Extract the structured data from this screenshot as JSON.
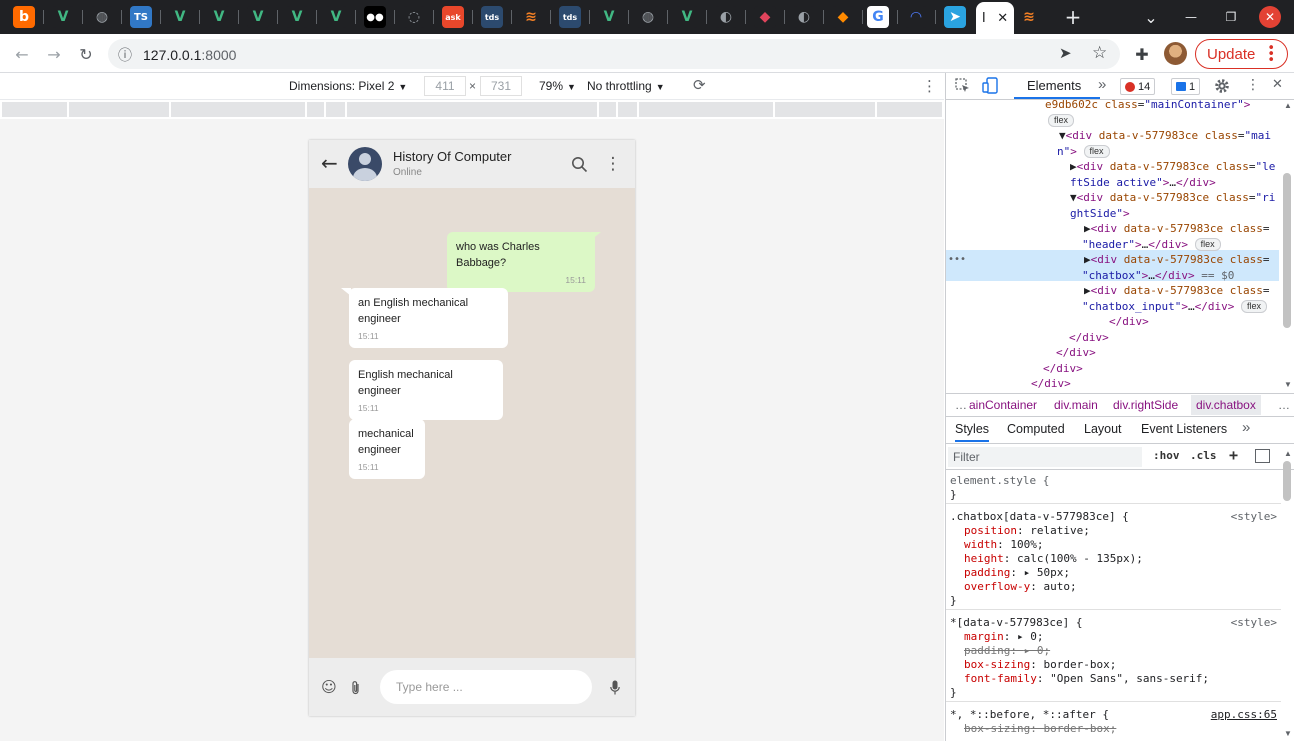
{
  "browser": {
    "tabs": [
      {
        "icon": "b",
        "bg": "#ff6a00",
        "fg": "#ffffff"
      },
      {
        "icon": "V",
        "bg": "#202124",
        "fg": "#41b883"
      },
      {
        "icon": "◍",
        "bg": "#202124",
        "fg": "#9aa0a6"
      },
      {
        "icon": "TS",
        "bg": "#3178c6",
        "fg": "#ffffff"
      },
      {
        "icon": "V",
        "bg": "#202124",
        "fg": "#41b883"
      },
      {
        "icon": "V",
        "bg": "#202124",
        "fg": "#41b883"
      },
      {
        "icon": "V",
        "bg": "#202124",
        "fg": "#41b883"
      },
      {
        "icon": "V",
        "bg": "#202124",
        "fg": "#41b883"
      },
      {
        "icon": "V",
        "bg": "#202124",
        "fg": "#41b883"
      },
      {
        "icon": "●●",
        "bg": "#000000",
        "fg": "#ffffff"
      },
      {
        "icon": "◌",
        "bg": "#202124",
        "fg": "#9aa0a6"
      },
      {
        "icon": "ask",
        "bg": "#e8472b",
        "fg": "#ffffff"
      },
      {
        "icon": "tds",
        "bg": "#2c4a6e",
        "fg": "#ffffff"
      },
      {
        "icon": "≋",
        "bg": "#202124",
        "fg": "#f48024"
      },
      {
        "icon": "tds",
        "bg": "#2c4a6e",
        "fg": "#ffffff"
      },
      {
        "icon": "V",
        "bg": "#202124",
        "fg": "#41b883"
      },
      {
        "icon": "◍",
        "bg": "#202124",
        "fg": "#9aa0a6"
      },
      {
        "icon": "V",
        "bg": "#202124",
        "fg": "#41b883"
      },
      {
        "icon": "◐",
        "bg": "#202124",
        "fg": "#9aa0a6"
      },
      {
        "icon": "◆",
        "bg": "#202124",
        "fg": "#e0445c"
      },
      {
        "icon": "◐",
        "bg": "#202124",
        "fg": "#9aa0a6"
      },
      {
        "icon": "◆",
        "bg": "#202124",
        "fg": "#ff8a00"
      },
      {
        "icon": "G",
        "bg": "#ffffff",
        "fg": "#4285f4"
      },
      {
        "icon": "◠",
        "bg": "#202124",
        "fg": "#4f7cff"
      },
      {
        "icon": "➤",
        "bg": "#2aa3e0",
        "fg": "#ffffff"
      }
    ],
    "active_tab": {
      "title": "I",
      "close": "✕",
      "icon": "≋"
    },
    "new_tab": "+",
    "tab_search": "⌄",
    "window_controls": {
      "minimize": "—",
      "restore": "❐",
      "close": "✕"
    },
    "url_host": "127.0.0.1",
    "url_port": ":8000",
    "update_label": "Update",
    "toolbar_icons": {
      "back": "←",
      "forward": "→",
      "reload": "↻",
      "info": "ⓘ",
      "send": "➤",
      "star": "☆",
      "extensions": "✚"
    }
  },
  "device_toolbar": {
    "dimensions_label": "Dimensions: Pixel 2",
    "width": "411",
    "times": "×",
    "height": "731",
    "zoom": "79%",
    "throttling": "No throttling",
    "caret": "▼",
    "rotate_icon": "⟳",
    "more": "⋮"
  },
  "chat": {
    "contact_name": "History Of Computer",
    "contact_status": "Online",
    "icons": {
      "back": "←",
      "search": "⌕",
      "menu": "⋮",
      "emoji": "☺",
      "attach": "⌇",
      "mic": "🎤"
    },
    "messages": [
      {
        "text": "who was Charles Babbage?",
        "time": "15:11",
        "type": "sent"
      },
      {
        "text": "an English mechanical engineer",
        "time": "15:11",
        "type": "received"
      },
      {
        "text": "English mechanical engineer",
        "time": "15:11",
        "type": "received"
      },
      {
        "text": "mechanical engineer",
        "time": "15:11",
        "type": "received"
      }
    ],
    "input_placeholder": "Type here ..."
  },
  "devtools": {
    "tab_elements": "Elements",
    "more_tabs": "»",
    "errors": "14",
    "messages": "1",
    "dom_lines": [
      {
        "html": "<span class='attr'>e9db602c</span> <span class='attr'>class</span>=<span class='val'>\"mainContainer\"</span><span class='tag'>&gt;</span>"
      },
      {
        "html": "<span class='pill'>flex</span>"
      },
      {
        "html": "▼<span class='tag'>&lt;div</span> <span class='attr'>data-v-577983ce</span> <span class='attr'>class</span>=<span class='val'>\"mai</span>"
      },
      {
        "html": "<span class='val'>n\"</span><span class='tag'>&gt;</span> <span class='pill'>flex</span>"
      },
      {
        "html": "▶<span class='tag'>&lt;div</span> <span class='attr'>data-v-577983ce</span> <span class='attr'>class</span>=<span class='val'>\"le</span>"
      },
      {
        "html": "<span class='val'>ftSide active\"</span><span class='tag'>&gt;</span>…<span class='tag'>&lt;/div&gt;</span>"
      },
      {
        "html": "▼<span class='tag'>&lt;div</span> <span class='attr'>data-v-577983ce</span> <span class='attr'>class</span>=<span class='val'>\"ri</span>"
      },
      {
        "html": "<span class='val'>ghtSide\"</span><span class='tag'>&gt;</span>"
      },
      {
        "html": "▶<span class='tag'>&lt;div</span> <span class='attr'>data-v-577983ce</span> <span class='attr'>class</span>="
      },
      {
        "html": "<span class='val'>\"header\"</span><span class='tag'>&gt;</span>…<span class='tag'>&lt;/div&gt;</span> <span class='pill'>flex</span>"
      },
      {
        "html": "▶<span class='tag'>&lt;div</span> <span class='attr'>data-v-577983ce</span> <span class='attr'>class</span>="
      },
      {
        "html": "<span class='val'>\"chatbox\"</span><span class='tag'>&gt;</span>…<span class='tag'>&lt;/div&gt;</span> <span style='color:#5f6368'>== $0</span>"
      },
      {
        "html": "▶<span class='tag'>&lt;div</span> <span class='attr'>data-v-577983ce</span> <span class='attr'>class</span>="
      },
      {
        "html": "<span class='val'>\"chatbox_input\"</span><span class='tag'>&gt;</span>…<span class='tag'>&lt;/div&gt;</span> <span class='pill'>flex</span>"
      },
      {
        "html": "<span class='tag'>&lt;/div&gt;</span>"
      },
      {
        "html": "<span class='tag'>&lt;/div&gt;</span>"
      },
      {
        "html": "<span class='tag'>&lt;/div&gt;</span>"
      },
      {
        "html": "<span class='tag'>&lt;/div&gt;</span>"
      },
      {
        "html": "<span class='tag'>&lt;/div&gt;</span>"
      }
    ],
    "breadcrumbs": [
      "…",
      "ainContainer",
      "div.main",
      "div.rightSide",
      "div.chatbox",
      "…"
    ],
    "subtabs": [
      "Styles",
      "Computed",
      "Layout",
      "Event Listeners",
      "»"
    ],
    "filter_placeholder": "Filter",
    "hov": ":hov",
    "cls": ".cls",
    "plus": "+",
    "rules": [
      {
        "selector": "element.style {",
        "source": "",
        "props": [],
        "close": "}"
      },
      {
        "selector": ".chatbox[data-v-577983ce] {",
        "source": "<style>",
        "props": [
          {
            "name": "position",
            "value": "relative;",
            "strike": false
          },
          {
            "name": "width",
            "value": "100%;",
            "strike": false
          },
          {
            "name": "height",
            "value": "calc(100% - 135px);",
            "strike": false
          },
          {
            "name": "padding",
            "value": "▸ 50px;",
            "strike": false
          },
          {
            "name": "overflow-y",
            "value": "auto;",
            "strike": false
          }
        ],
        "close": "}"
      },
      {
        "selector": "*[data-v-577983ce] {",
        "source": "<style>",
        "props": [
          {
            "name": "margin",
            "value": "▸ 0;",
            "strike": false
          },
          {
            "name": "padding",
            "value": "▸ 0;",
            "strike": true
          },
          {
            "name": "box-sizing",
            "value": "border-box;",
            "strike": false
          },
          {
            "name": "font-family",
            "value": "\"Open Sans\", sans-serif;",
            "strike": false
          }
        ],
        "close": "}"
      },
      {
        "selector": "*, *::before, *::after {",
        "source": "app.css:65",
        "props": [
          {
            "name": "box-sizing",
            "value": "border-box;",
            "strike": true
          }
        ],
        "close": ""
      }
    ]
  }
}
